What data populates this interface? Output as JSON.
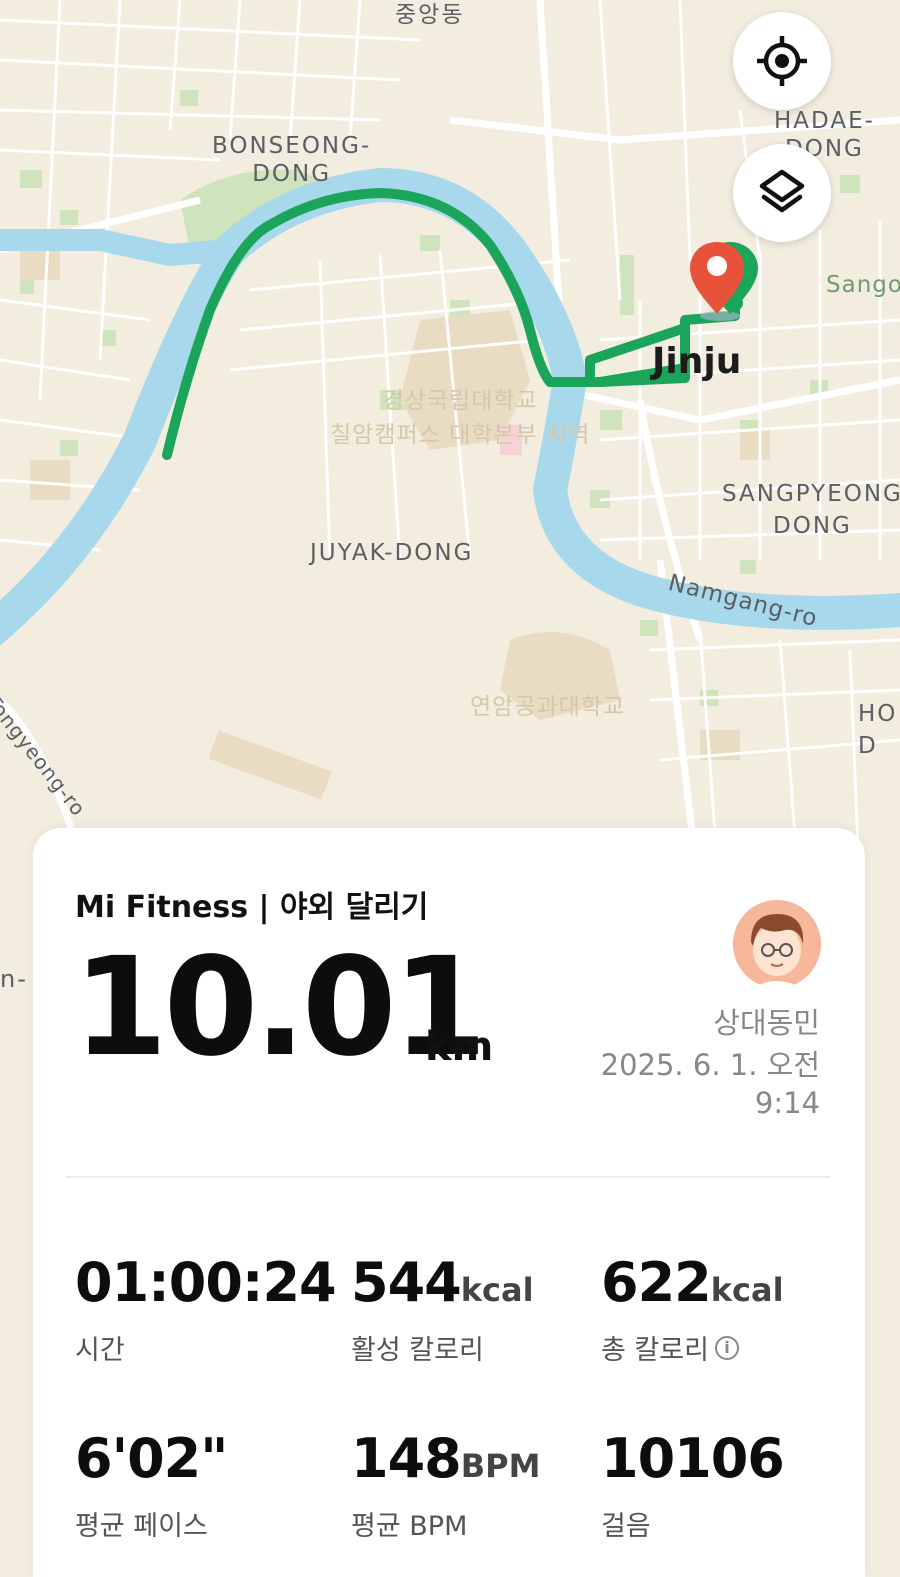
{
  "map": {
    "labels": {
      "jungang": "중앙동",
      "hadae": "HADAE-\nDONG",
      "bonseong": "BONSEONG-\nDONG",
      "sang": "Sango",
      "jinju": "Jinju",
      "univ1": "경상국립대학교\n칠암캠퍼스 대학본부 지역",
      "sangpyeong": "SANGPYEONG\nDONG",
      "juyak": "JUYAK-DONG",
      "namgang": "Namgang-ro",
      "univ2": "연암공과대학교",
      "tongyeong": "Tongyeong-ro",
      "ho": "HO\nD",
      "n": "n-"
    },
    "icons": {
      "locate": "locate-target-icon",
      "layers": "layers-icon",
      "pin": "map-pin-icon"
    },
    "route_color": "#1aa55a",
    "pin_color": "#e8523a"
  },
  "workout": {
    "title": "Mi Fitness | 야외 달리기",
    "distance": "10.01",
    "distance_unit": "km",
    "user_name": "상대동민",
    "date_line1": "2025. 6. 1. 오전",
    "date_line2": "9:14"
  },
  "stats": {
    "time": {
      "value": "01:00:24",
      "label": "시간"
    },
    "active_cal": {
      "value": "544",
      "unit": "kcal",
      "label": "활성 칼로리"
    },
    "total_cal": {
      "value": "622",
      "unit": "kcal",
      "label": "총 칼로리"
    },
    "pace": {
      "value": "6'02\"",
      "label": "평균 페이스"
    },
    "bpm": {
      "value": "148",
      "unit": "BPM",
      "label": "평균 BPM"
    },
    "steps": {
      "value": "10106",
      "label": "걸음"
    }
  }
}
